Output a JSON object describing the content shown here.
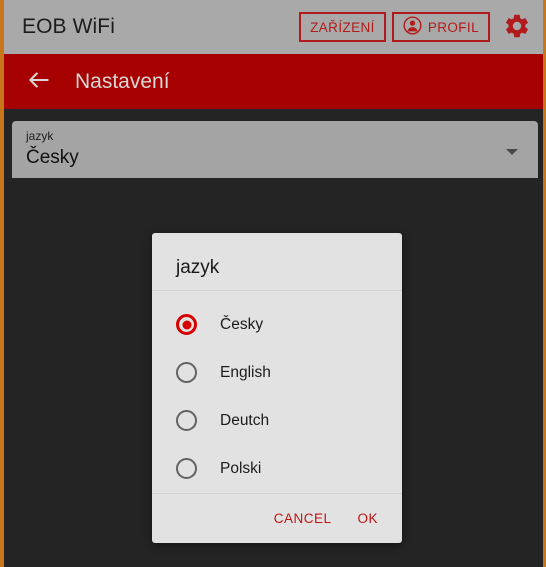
{
  "appbar": {
    "title": "EOB WiFi",
    "devices_button": "ZAŘÍZENÍ",
    "profile_button": "PROFIL",
    "icons": {
      "profile": "person-icon",
      "settings": "gear-icon"
    },
    "background_color": "#a9a9a9",
    "accent_color": "#b21b1b"
  },
  "subbar": {
    "title": "Nastavení",
    "back_icon": "arrow-left-icon",
    "background_color": "#a70000",
    "title_color": "#d8d8d8"
  },
  "select_field": {
    "label": "jazyk",
    "value": "Česky",
    "arrow_icon": "chevron-down-icon",
    "background_color": "#a4a4a4"
  },
  "dialog": {
    "title": "jazyk",
    "options": [
      {
        "label": "Česky",
        "selected": true
      },
      {
        "label": "English",
        "selected": false
      },
      {
        "label": "Deutch",
        "selected": false
      },
      {
        "label": "Polski",
        "selected": false
      }
    ],
    "cancel_label": "CANCEL",
    "ok_label": "OK",
    "background_color": "#e2e2e2",
    "action_color": "#c01414",
    "radio_selected_color": "#d50000"
  },
  "page": {
    "background_color": "#242424",
    "edge_accent_color": "#c8761a"
  }
}
